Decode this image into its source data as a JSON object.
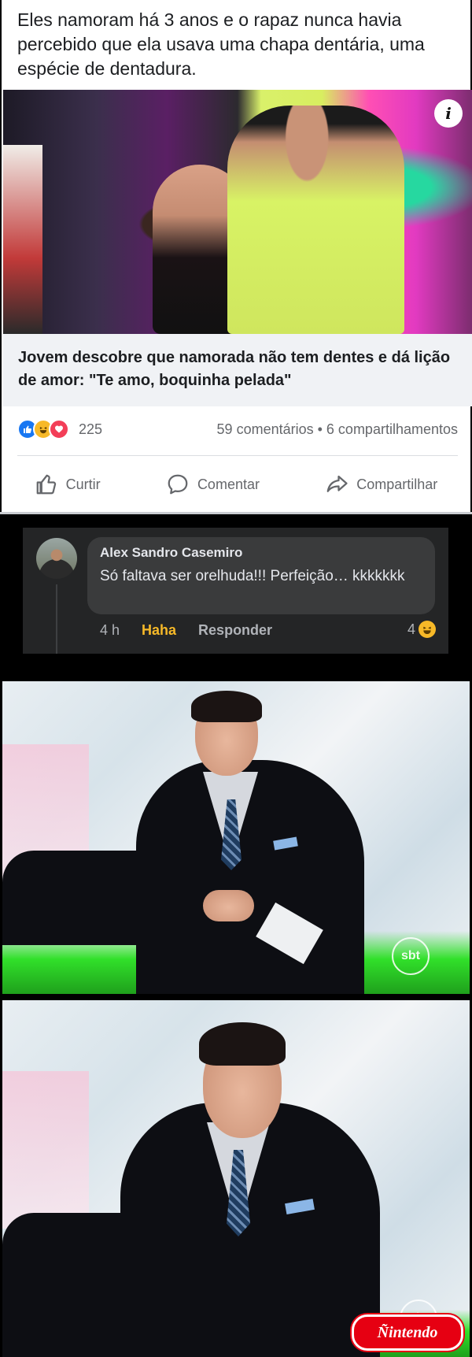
{
  "post": {
    "caption": "Eles namoram há 3 anos e o rapaz nunca havia percebido que ela usava uma chapa dentária, uma espécie de dentadura.",
    "info_badge": "i",
    "link_title": "Jovem descobre que namorada não tem dentes e dá lição de amor: \"Te amo, boquinha pelada\"",
    "reactions": {
      "icons": [
        "like-icon",
        "haha-icon",
        "love-icon"
      ],
      "count": "225",
      "comments_shares": "59 comentários • 6 compartilhamentos"
    },
    "actions": {
      "like": "Curtir",
      "comment": "Comentar",
      "share": "Compartilhar"
    }
  },
  "comment": {
    "author": "Alex Sandro Casemiro",
    "text": "Só faltava ser orelhuda!!! Perfeição… kkkkkkk",
    "time": "4 h",
    "reaction_link": "Haha",
    "reply": "Responder",
    "reaction_count": "4"
  },
  "memes": {
    "frame1_logo": "sbt",
    "frame2_logo": "sbt",
    "watermark": "Ñintendo"
  },
  "colors": {
    "fb_blue": "#1877f2",
    "haha_yellow": "#f7b928",
    "love_red": "#f33e58",
    "dark_panel": "#242526",
    "bubble": "#3a3b3c"
  }
}
